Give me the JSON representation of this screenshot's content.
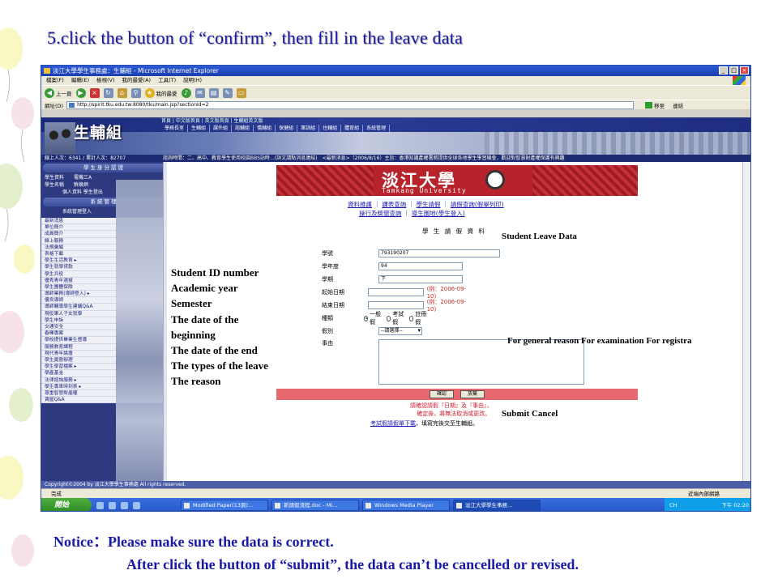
{
  "slide": {
    "title": "5.click the button of “confirm”, then fill in the leave data",
    "notice_line1": "Notice：Please make sure the data is correct.",
    "notice_line2": "After click the button of “submit”, the data can’t be cancelled or revised."
  },
  "browser": {
    "window_title": "淡江大學學生事務處：生輔組 - Microsoft Internet Explorer",
    "menu": [
      "檔案(F)",
      "編輯(E)",
      "檢視(V)",
      "我的最愛(A)",
      "工具(T)",
      "說明(H)"
    ],
    "toolbar": {
      "back": "上一頁",
      "favorites": "我的最愛"
    },
    "address_label": "網址(D)",
    "address": "http://spirit.tku.edu.tw:8080/tku/main.jsp?sectionId=2",
    "go_label": "移至",
    "links_label": "連結",
    "status_text": "完成",
    "status_zone": "近端內部網路"
  },
  "site": {
    "top_links": "首頁 | 中文版首頁 | 英文版首頁 | 生輔組英文版",
    "tabs": [
      "學務長室",
      "生輔組",
      "課外組",
      "諮輔組",
      "僑輔組",
      "保健組",
      "軍訓組",
      "住輔組",
      "體育組",
      "系統管理"
    ],
    "logo": "生輔組",
    "visitor_count": "線上人次：6341 / 累計人次：82707",
    "marquee": "諮詢時間：二、高中、教育學生使用校園BBS站時…(詳文請點消息連結)　<最新消息>（2006/8/16）主旨：香港知識產權署將提供全球各地學生學習機會，歡迎對智慧財產權保護有興趣",
    "sidebar": {
      "section1": "學生身分認證",
      "links1": [
        "學生資料　　電機三A",
        "學生名稱　　鮮煥炳"
      ],
      "link_indent": "個人資料 學生登出",
      "section2": "系統管理",
      "link2": "系統管理登入",
      "menu": [
        "最新消息",
        "單位簡介",
        "成員簡介",
        "線上服務",
        "法規彙編",
        "表格下載",
        "學生生活教育 ▸",
        "學生就學貸款",
        "學生兵役",
        "優秀青年選拔",
        "學生團體保險",
        "導師業務(導師登入) ▸",
        "優良導師",
        "導師輔導學生建議Q&A",
        "現役軍人子女就學",
        "學生申訴",
        "交通安全",
        "春暉專案",
        "學校提供畢業生督導",
        "服務教育課程",
        "現代青年論壇",
        "學生獎懲辦理",
        "學生學習檔案 ▸",
        "學產基金",
        "法律諮詢服務 ▸",
        "學生專車時刻表 ▸",
        "尊重智慧財產權",
        "賃屋Q&A"
      ]
    },
    "banner_cn": "淡江大學",
    "banner_en": "Tamkang University",
    "nav_row1": [
      "資料維護",
      "課表查詢",
      "學生請假",
      "請假查詢(假單列印)"
    ],
    "nav_row2": [
      "操行及獎懲查詢",
      "導生園地(學生登入)"
    ],
    "form_title": "學 生 請 假 資 料",
    "fields": {
      "student_id_label": "學號",
      "student_id_value": "793190207",
      "year_label": "學年度",
      "year_value": "94",
      "semester_label": "學期",
      "semester_value": "下",
      "start_label": "起始日期",
      "start_hint": "(例：2006-09-10)",
      "end_label": "結束日期",
      "end_hint": "(例：2006-09-10)",
      "type_label": "種類",
      "type_options": [
        "一般假",
        "考試假",
        "註冊假"
      ],
      "leave_label": "假別",
      "leave_select": "--請選擇--",
      "reason_label": "事由"
    },
    "buttons": {
      "confirm": "確認",
      "cancel": "放棄"
    },
    "warn_line1": "請確認請假『日期』及『事由』，",
    "warn_line2": "確定後，將無法取消或更改。",
    "exam_link": "考試假請假單下載",
    "exam_suffix": "，填寫完後交至生輔組。",
    "copyright": "Copyright©2004 by 淡江大學學生事務處 All rights reserved."
  },
  "taskbar": {
    "start": "開始",
    "tasks": [
      "Modified Paper(13頁)…",
      "新請假流程.doc - Mi…",
      "Windows Media Player",
      "淡江大學學生事務…"
    ],
    "lang": "CH",
    "clock": "下午 02:20"
  },
  "overlays": {
    "leave_data": "Student Leave Data",
    "left_labels": [
      "Student ID number",
      "Academic year",
      "Semester",
      "The date of the",
      "beginning",
      "The date of the end",
      "The types of the leave",
      "The reason"
    ],
    "type_labels": "For general reason For examination  For registra",
    "submit_cancel": "Submit Cancel"
  }
}
